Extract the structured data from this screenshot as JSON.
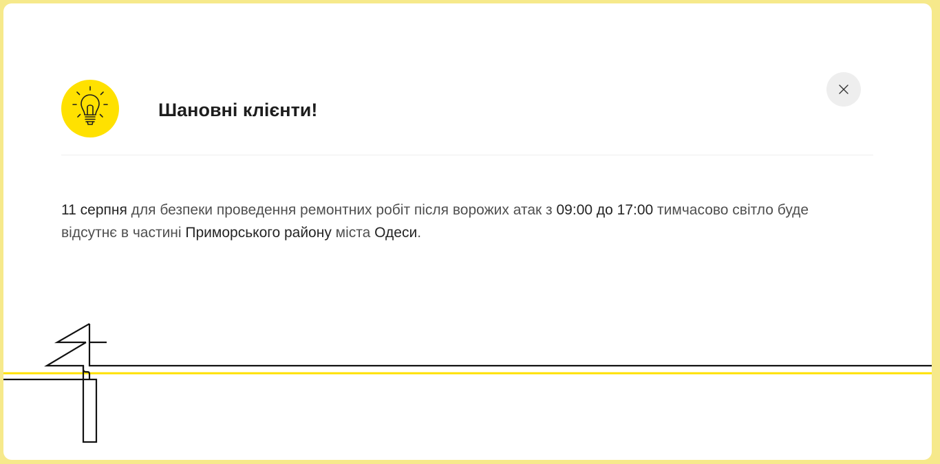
{
  "modal": {
    "title": "Шановні клієнти!",
    "icon": "lightbulb-icon",
    "close_icon": "close-icon",
    "message": {
      "date": "11 серпня",
      "part1": " для безпеки проведення ремонтних робіт після ворожих атак з ",
      "time": "09:00 до 17:00",
      "part2": " тимчасово світло буде відсутнє в частині ",
      "district": "Приморського району",
      "part3": " міста ",
      "city": "Одеси",
      "end": "."
    }
  },
  "colors": {
    "page_background": "#f6e98b",
    "accent_yellow": "#ffe100",
    "text_dark": "#1d1d1d",
    "text_body": "#4f4f4f"
  }
}
